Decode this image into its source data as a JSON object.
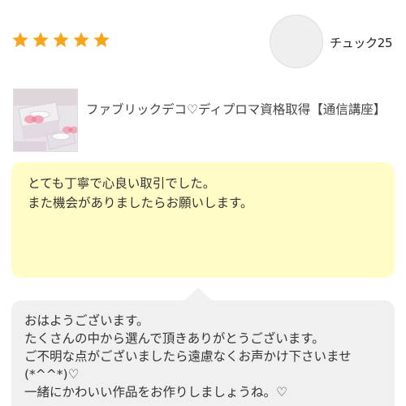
{
  "review": {
    "rating": 5,
    "star_color": "#f7a51b",
    "reviewer_name": "チュック25",
    "avatar_icon": "user-avatar-placeholder"
  },
  "product": {
    "title": "ファブリックデコ♡ディプロマ資格取得【通信講座】",
    "thumbnail_icon": "fabric-deco-tissue-box-photo"
  },
  "comment": {
    "text": "とても丁寧で心良い取引でした。\nまた機会がありましたらお願いします。",
    "background": "#fffcc6"
  },
  "reply": {
    "text": "おはようございます。\nたくさんの中から選んで頂きありがとうございます。\nご不明な点がございましたら遠慮なくお声かけ下さいませ(*^^*)♡\n一緒にかわいい作品をお作りしましょうね。♡",
    "background": "#f0f0f0"
  }
}
